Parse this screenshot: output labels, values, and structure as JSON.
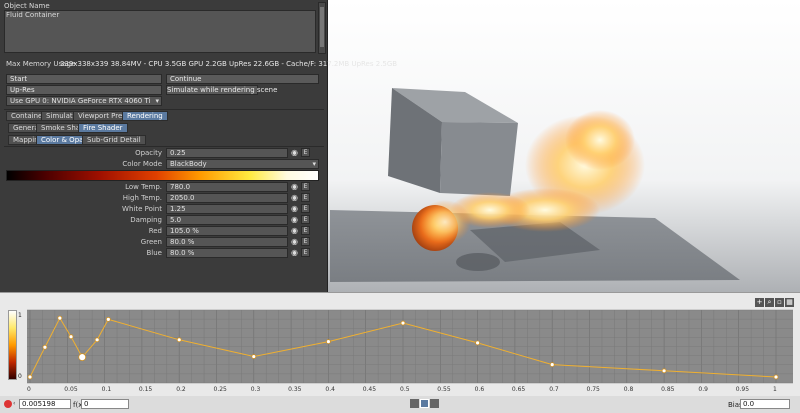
{
  "object_list": {
    "header": "Object Name",
    "items": [
      "Fluid Container"
    ]
  },
  "memory": {
    "label": "Max Memory Usage",
    "value": "339x338x339 38.84MV - CPU 3.5GB GPU 2.2GB UpRes 22.6GB - Cache/F: 317.2MB UpRes 2.5GB"
  },
  "buttons": {
    "start": "Start",
    "continue": "Continue",
    "upres": "Up-Res",
    "simulate_while_rendering": "Simulate while rendering scene"
  },
  "gpu_select": "Use GPU 0: NVIDIA GeForce RTX 4060 Ti",
  "tabs_main": [
    {
      "label": "Container",
      "active": false
    },
    {
      "label": "Simulation",
      "active": false
    },
    {
      "label": "Viewport Preview",
      "active": false
    },
    {
      "label": "Rendering",
      "active": true
    }
  ],
  "tabs_shader": [
    {
      "label": "General",
      "active": false
    },
    {
      "label": "Smoke Shader",
      "active": false
    },
    {
      "label": "Fire Shader",
      "active": true
    }
  ],
  "tabs_sub": [
    {
      "label": "Mapping",
      "active": false
    },
    {
      "label": "Color & Opacity",
      "active": true
    },
    {
      "label": "Sub-Grid Detail",
      "active": false
    }
  ],
  "opacity": {
    "label": "Opacity",
    "value": "0.25"
  },
  "color_mode": {
    "label": "Color Mode",
    "value": "BlackBody"
  },
  "params": [
    {
      "label": "Low Temp.",
      "value": "780.0"
    },
    {
      "label": "High Temp.",
      "value": "2050.0"
    },
    {
      "label": "White Point",
      "value": "1.25"
    },
    {
      "label": "Damping",
      "value": "5.0"
    },
    {
      "label": "Red",
      "value": "105.0 %"
    },
    {
      "label": "Green",
      "value": "80.0 %"
    },
    {
      "label": "Blue",
      "value": "80.0 %"
    }
  ],
  "e_label": "E",
  "eye_glyph": "◉",
  "graph": {
    "y_label_top": "1",
    "y_label_bottom": "0",
    "x_ticks": [
      "0",
      "0.05",
      "0.1",
      "0.15",
      "0.2",
      "0.25",
      "0.3",
      "0.35",
      "0.4",
      "0.45",
      "0.5",
      "0.55",
      "0.6",
      "0.65",
      "0.7",
      "0.75",
      "0.8",
      "0.85",
      "0.9",
      "0.95",
      "1"
    ],
    "curve": [
      [
        0.0,
        0.0
      ],
      [
        0.02,
        0.48
      ],
      [
        0.04,
        0.95
      ],
      [
        0.055,
        0.65
      ],
      [
        0.07,
        0.32
      ],
      [
        0.09,
        0.6
      ],
      [
        0.105,
        0.93
      ],
      [
        0.2,
        0.6
      ],
      [
        0.3,
        0.33
      ],
      [
        0.4,
        0.57
      ],
      [
        0.5,
        0.87
      ],
      [
        0.6,
        0.55
      ],
      [
        0.7,
        0.2
      ],
      [
        0.85,
        0.1
      ],
      [
        1.0,
        0.0
      ]
    ],
    "selected_key": 4,
    "x_input": "0.005198",
    "fx_label": "f(x)",
    "fx_input": "0",
    "bias_label": "Bias",
    "bias_input": "0.0"
  }
}
